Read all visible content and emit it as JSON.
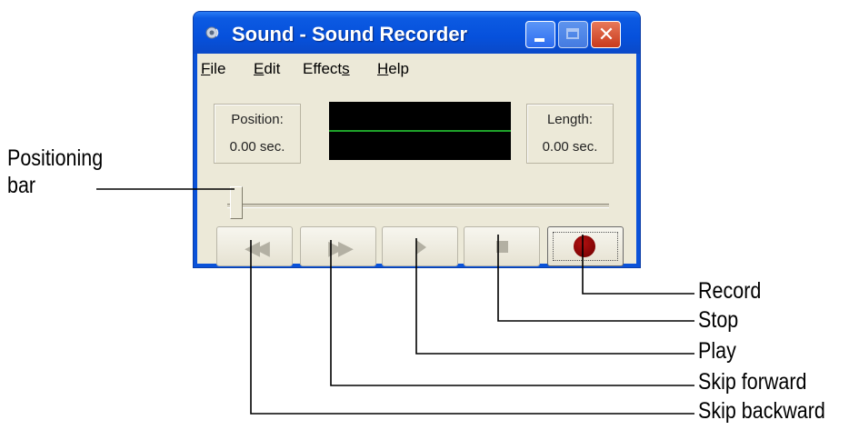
{
  "window": {
    "title": "Sound - Sound Recorder",
    "controls": {
      "minimize": "minimize",
      "maximize": "maximize",
      "close": "close"
    }
  },
  "menu": {
    "file": {
      "mnemonic": "F",
      "rest": "ile"
    },
    "edit": {
      "mnemonic": "E",
      "rest": "dit"
    },
    "effects": {
      "pre": "Effect",
      "mnemonic": "s",
      "rest": ""
    },
    "help": {
      "mnemonic": "H",
      "rest": "elp"
    }
  },
  "position": {
    "label": "Position:",
    "value": "0.00 sec."
  },
  "length": {
    "label": "Length:",
    "value": "0.00 sec."
  },
  "slider": {
    "position_fraction": 0.0
  },
  "buttons": {
    "skip_backward_glyph": "◀◀",
    "skip_forward_glyph": "▶▶"
  },
  "callouts": {
    "positioning_bar_line1": "Positioning",
    "positioning_bar_line2": "bar",
    "record": "Record",
    "stop": "Stop",
    "play": "Play",
    "skip_forward": "Skip forward",
    "skip_backward": "Skip backward"
  },
  "colors": {
    "title_bar": "#0651dc",
    "client_bg": "#ece9d8",
    "wave_bg": "#000000",
    "wave_line": "#1ea22a",
    "record_dot": "#8b0000",
    "close_button": "#c83a1c"
  }
}
